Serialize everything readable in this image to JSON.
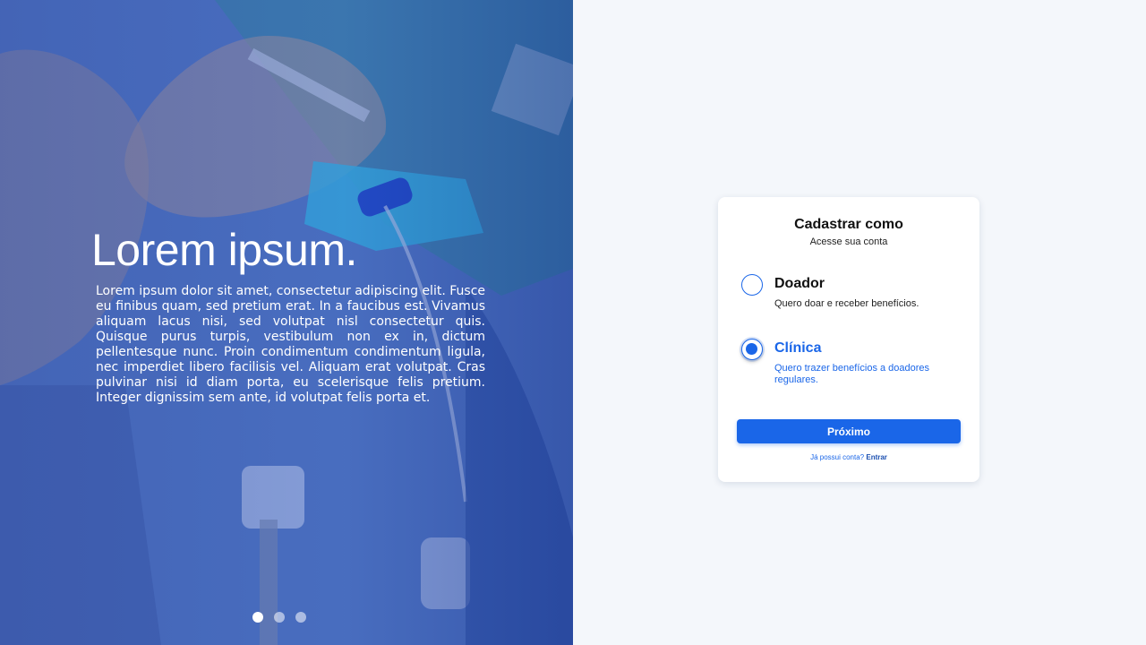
{
  "hero": {
    "title": "Lorem ipsum.",
    "text": "Lorem ipsum dolor sit amet, consectetur adipiscing elit. Fusce eu finibus quam, sed pretium erat. In a faucibus est. Vivamus aliquam lacus nisi, sed volutpat nisl consectetur quis. Quisque purus turpis, vestibulum non ex in, dictum pellentesque nunc. Proin condimentum condimentum ligula, nec imperdiet libero facilisis vel. Aliquam erat volutpat. Cras pulvinar nisi id diam porta, eu scelerisque felis pretium. Integer dignissim sem ante, id volutpat felis porta et.",
    "slides": {
      "count": 3,
      "active": 1
    }
  },
  "form": {
    "title": "Cadastrar como",
    "subtitle": "Acesse sua conta",
    "options": [
      {
        "label": "Doador",
        "description": "Quero doar e receber benefícios.",
        "selected": false
      },
      {
        "label": "Clínica",
        "description": "Quero trazer benefícios a doadores regulares.",
        "selected": true
      }
    ],
    "next_label": "Próximo",
    "login_prompt": "Já possui conta?",
    "login_link": "Entrar"
  },
  "colors": {
    "accent": "#1a66e8",
    "page_background": "#f4f7fb",
    "card_background": "#ffffff"
  }
}
